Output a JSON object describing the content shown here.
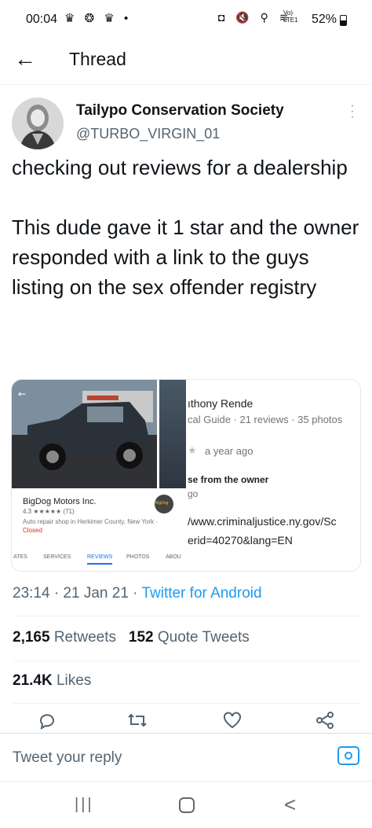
{
  "status_bar": {
    "time": "00:04",
    "left_icons": "♛ ❂ ♛ •",
    "right_icons": "◘ 🔇 ⚲ ≋",
    "network": "Vo) LTE1",
    "battery": "52%"
  },
  "header": {
    "back_icon": "←",
    "title": "Thread"
  },
  "tweet": {
    "display_name": "Tailypo Conservation Society",
    "handle": "@TURBO_VIRGIN_01",
    "text": "checking out reviews for a dealership\n\nThis dude gave it 1 star and the owner responded with a link to the guys listing on the sex offender registry",
    "timestamp": "23:14 · 21 Jan 21 · ",
    "source": "Twitter for Android",
    "retweets_count": "2,165",
    "retweets_label": "Retweets",
    "quotes_count": "152",
    "quotes_label": "Quote Tweets",
    "likes_count": "21.4K",
    "likes_label": "Likes"
  },
  "media": {
    "business_name": "BigDog Motors Inc.",
    "rating": "4.3 ★★★★★ (71)",
    "description": "Auto repair shop in Herkimer County, New York · ",
    "status": "Closed",
    "logo_text": "BigDog",
    "tabs": [
      "ATES",
      "SERVICES",
      "REVIEWS",
      "PHOTOS",
      "ABOU"
    ],
    "reviewer_name": "ıthony Rende",
    "reviewer_meta": "cal Guide · 21 reviews · 35 photos",
    "review_time": "a year ago",
    "owner_response_label": "se from the owner",
    "owner_response_time": "go",
    "link_line1": "/www.criminaljustice.ny.gov/Sc",
    "link_line2": "erid=40270&lang=EN",
    "rating_stars": 1
  },
  "reply": {
    "placeholder": "Tweet your reply"
  },
  "nav": {
    "recent": "|||",
    "back": "<"
  },
  "colors": {
    "accent": "#1d9bf0",
    "text": "#0f1419",
    "secondary": "#536471"
  }
}
